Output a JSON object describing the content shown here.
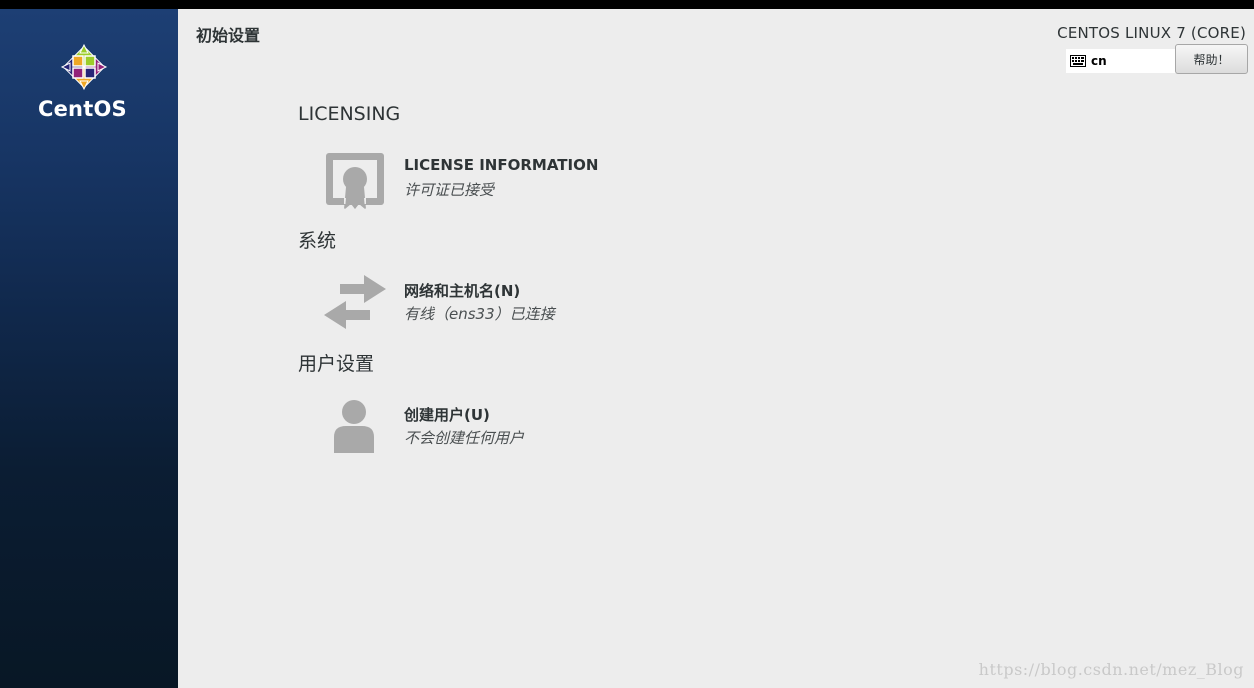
{
  "brand": {
    "logo_text": "CentOS"
  },
  "header": {
    "title": "初始设置",
    "os_name": "CENTOS LINUX 7 (CORE)",
    "keyboard_layout": "cn",
    "help_label": "帮助！"
  },
  "sections": [
    {
      "title": "LICENSING",
      "spokes": [
        {
          "icon": "license-certificate-icon",
          "title": "LICENSE INFORMATION",
          "status": "许可证已接受"
        }
      ]
    },
    {
      "title": "系统",
      "spokes": [
        {
          "icon": "network-arrows-icon",
          "title": "网络和主机名(N)",
          "status": "有线（ens33）已连接"
        }
      ]
    },
    {
      "title": "用户设置",
      "spokes": [
        {
          "icon": "user-icon",
          "title": "创建用户(U)",
          "status": "不会创建任何用户"
        }
      ]
    }
  ],
  "watermark": "https://blog.csdn.net/mez_Blog",
  "colors": {
    "sidebar_top": "#1d3f74",
    "sidebar_bottom": "#081725",
    "content_bg": "#ededed",
    "icon_gray": "#a9a9a9"
  }
}
